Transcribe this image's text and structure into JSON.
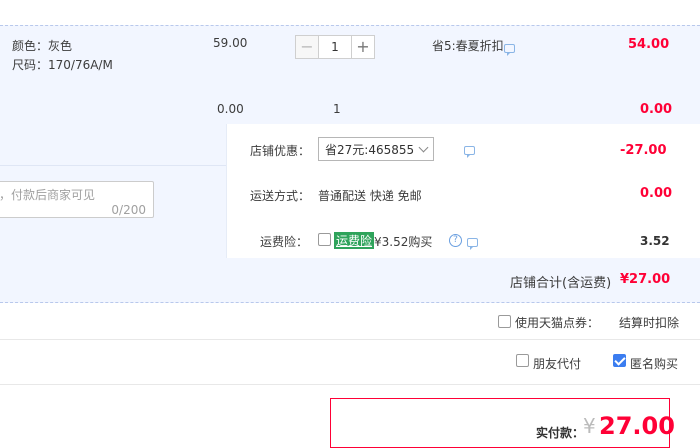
{
  "item": {
    "color_line": "颜色：灰色",
    "size_line": "尺码：170/76A/M",
    "unit_price": "59.00",
    "quantity": "1",
    "promo": "省5:春夏折扣",
    "line_total": "54.00",
    "subtotal_discount": "0.00",
    "subtotal_qty": "1",
    "subtotal_amount": "0.00"
  },
  "shop": {
    "coupon_label": "店铺优惠：",
    "coupon_value": "省27元:465855",
    "coupon_amount": "-27.00",
    "memo_placeholder": "，付款后商家可见",
    "memo_counter": "0/200",
    "shipping_label": "运送方式：",
    "shipping_value": "普通配送 快递 免邮",
    "shipping_amount": "0.00",
    "insurance_label": "运费险：",
    "insurance_tag": "运费险",
    "insurance_price": "¥3.52购买",
    "insurance_amount": "3.52",
    "shop_total_label": "店铺合计(含运费)",
    "shop_total_value": "¥27.00"
  },
  "options": {
    "tmall_points_label": "使用天猫点券：",
    "tmall_points_note": "结算时扣除",
    "friend_pay_label": "朋友代付",
    "anonymous_label": "匿名购买"
  },
  "payment": {
    "label": "实付款：",
    "currency": "¥",
    "amount": "27.00"
  },
  "colors": {
    "accent_red": "#ff0036",
    "panel_blue": "#f2f6ff",
    "checkbox_blue": "#3b7df0",
    "tag_green": "#2fa35b"
  }
}
